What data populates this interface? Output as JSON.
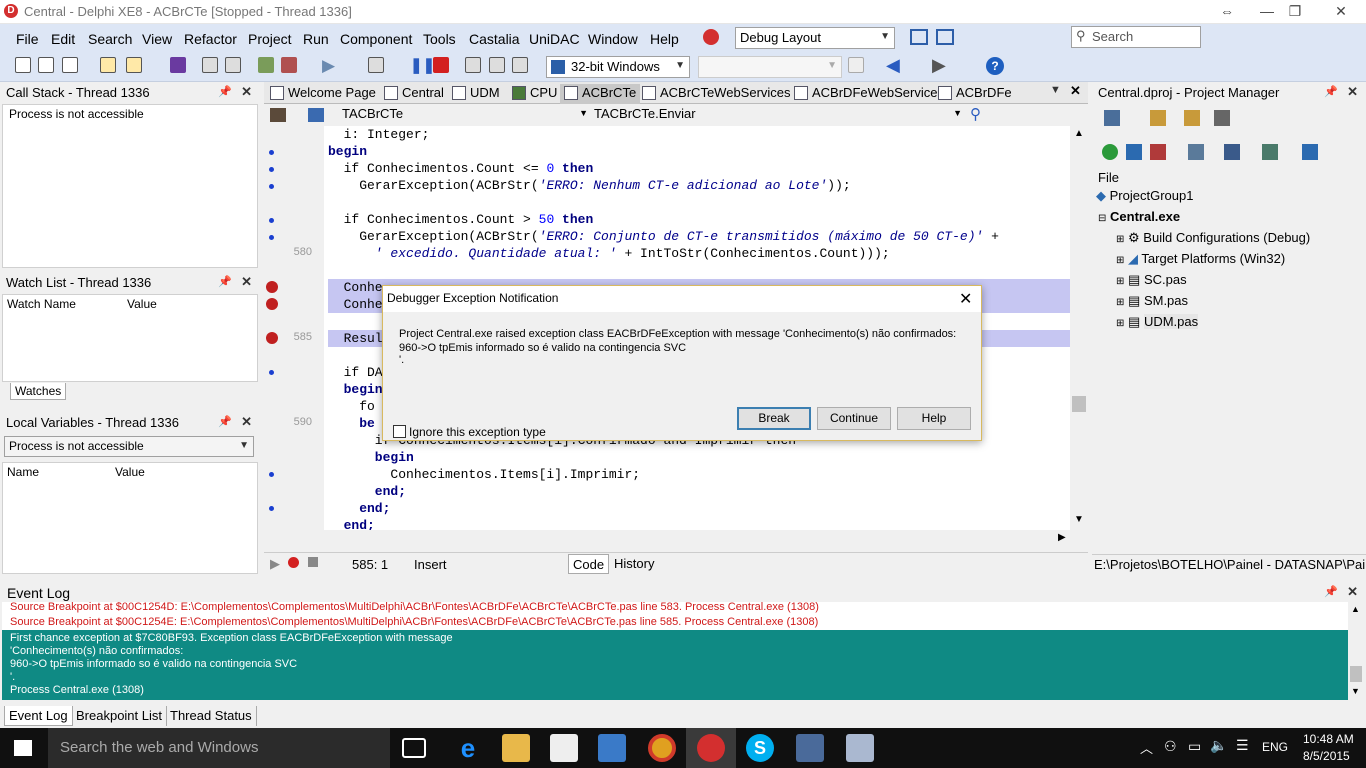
{
  "window": {
    "title": "Central - Delphi XE8 - ACBrCTe [Stopped - Thread 1336]",
    "minimize": "—",
    "maximize": "❐",
    "close": "✕",
    "restore_icon": "⇔"
  },
  "menu": [
    "File",
    "Edit",
    "Search",
    "View",
    "Refactor",
    "Project",
    "Run",
    "Component",
    "Tools",
    "Castalia",
    "UniDAC",
    "Window",
    "Help"
  ],
  "layout_combo": "Debug Layout",
  "search": {
    "placeholder": "Search"
  },
  "platform_combo": "32-bit Windows",
  "call_stack": {
    "title": "Call Stack - Thread 1336",
    "text": "Process is not accessible"
  },
  "watch_list": {
    "title": "Watch List - Thread 1336",
    "col_name": "Watch Name",
    "col_value": "Value",
    "tab": "Watches"
  },
  "locals": {
    "title": "Local Variables - Thread 1336",
    "combo": "Process is not accessible",
    "col_name": "Name",
    "col_value": "Value"
  },
  "tabs": [
    "Welcome Page",
    "Central",
    "UDM",
    "CPU",
    "ACBrCTe",
    "ACBrCTeWebServices",
    "ACBrDFeWebService",
    "ACBrDFe"
  ],
  "editor_combo_left": "TACBrCTe",
  "editor_combo_right": "TACBrCTe.Enviar",
  "line_numbers": {
    "l580": "580",
    "l585": "585",
    "l590": "590"
  },
  "code": {
    "l1": "  i: Integer;",
    "l2": "begin",
    "l3a": "  if Conhecimentos.Count <= ",
    "l3n": "0",
    "l3b": " then",
    "l4a": "    GerarException(ACBrStr(",
    "l4s": "'ERRO: Nenhum CT-e adicionad ao Lote'",
    "l4b": "));",
    "l6a": "  if Conhecimentos.Count > ",
    "l6n": "50",
    "l6b": " then",
    "l7a": "    GerarException(ACBrStr(",
    "l7s": "'ERRO: Conjunto de CT-e transmitidos (máximo de 50 CT-e)'",
    "l7b": " +",
    "l8s": "      ' excedido. Quantidade atual: '",
    "l8b": " + IntToStr(Conhecimentos.Count)));",
    "l10": "  Conhe",
    "l11": "  Conhe",
    "l13": "  Resul",
    "l15": "  if DA",
    "l16": "  begin",
    "l17": "    fo",
    "l18": "    be",
    "l19": "      if Conhecimentos.Items[i].Confirmado and Imprimir then",
    "l20": "      begin",
    "l21": "        Conhecimentos.Items[i].Imprimir;",
    "l22": "      end;",
    "l23": "    end;",
    "l24": "  end;"
  },
  "editor_status": {
    "position": "585:  1",
    "mode": "Insert",
    "tab_code": "Code",
    "tab_history": "History"
  },
  "dialog": {
    "title": "Debugger Exception Notification",
    "msg1": "Project Central.exe raised exception class EACBrDFeException with message 'Conhecimento(s) não confirmados:",
    "msg2": "960->O tpEmis informado so é valido na contingencia SVC",
    "msg3": "'.",
    "ignore_label": "Ignore this exception type",
    "break": "Break",
    "continue": "Continue",
    "help": "Help"
  },
  "project_manager": {
    "title": "Central.dproj - Project Manager",
    "file_label": "File",
    "items": [
      "ProjectGroup1",
      "Central.exe",
      "Build Configurations (Debug)",
      "Target Platforms (Win32)",
      "SC.pas",
      "SM.pas",
      "UDM.pas"
    ],
    "path": "E:\\Projetos\\BOTELHO\\Painel - DATASNAP\\Paine"
  },
  "event_log": {
    "title": "Event Log",
    "line1": "Source Breakpoint at $00C1254D: E:\\Complementos\\Complementos\\MultiDelphi\\ACBr\\Fontes\\ACBrDFe\\ACBrCTe\\ACBrCTe.pas line 583. Process Central.exe (1308)",
    "line2": "Source Breakpoint at $00C1254E: E:\\Complementos\\Complementos\\MultiDelphi\\ACBr\\Fontes\\ACBrDFe\\ACBrCTe\\ACBrCTe.pas line 585. Process Central.exe (1308)",
    "line3": "First chance exception at $7C80BF93. Exception class EACBrDFeException with message",
    "line4": "'Conhecimento(s) não confirmados:",
    "line5": "960->O tpEmis informado so é valido na contingencia SVC",
    "line6": "'.",
    "line7": "Process Central.exe (1308)",
    "tabs": [
      "Event Log",
      "Breakpoint List",
      "Thread Status"
    ]
  },
  "taskbar": {
    "search": "Search the web and Windows",
    "lang": "ENG",
    "time": "10:48 AM",
    "date": "8/5/2015"
  }
}
